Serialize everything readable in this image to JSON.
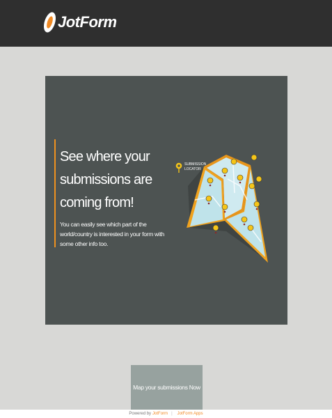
{
  "header": {
    "brand": "JotForm"
  },
  "banner": {
    "headline": "See where your submissions are coming from!",
    "description": "You can easily see which part of the world/country is interested in your form with some other info too.",
    "locator_line1": "SUBMISSION",
    "locator_line2": "LOCATOR"
  },
  "cta": {
    "label": "Map your submissions Now"
  },
  "footer": {
    "powered_by": "Powered by",
    "jotform_link": "JotForm",
    "apps_link": "JotForm Apps"
  },
  "colors": {
    "header_bg": "#2f2f2f",
    "page_bg": "#d8d8d6",
    "card_bg": "#4d5352",
    "accent": "#f0921e",
    "pin": "#f5c518",
    "button_bg": "#97a29f"
  },
  "icons": [
    "jotform-logo-icon",
    "map-pin-icon",
    "folded-map-icon"
  ]
}
